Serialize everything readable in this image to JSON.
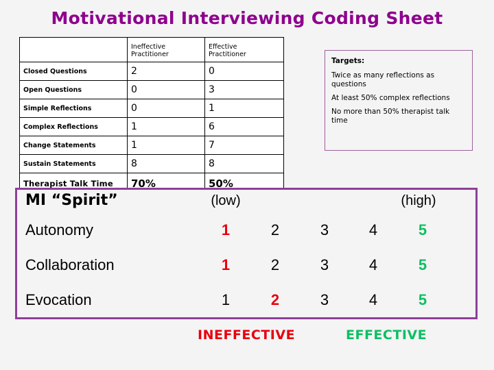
{
  "title": "Motivational Interviewing Coding Sheet",
  "colors": {
    "title_purple": "#8e008e",
    "panel_border_purple": "#8e3f99",
    "targets_border_purple": "#9b5f9b",
    "ineffective_red": "#e8000d",
    "effective_green": "#0dbf63",
    "page_background": "#f4f4f4"
  },
  "coding_table": {
    "headers": [
      "",
      "Ineffective Practitioner",
      "Effective Practitioner"
    ],
    "header_lines": {
      "col1_line1": "Ineffective",
      "col1_line2": "Practitioner",
      "col2_line1": "Effective",
      "col2_line2": "Practitioner"
    },
    "rows": [
      {
        "label": "Closed Questions",
        "ineffective": "2",
        "effective": "0"
      },
      {
        "label": "Open Questions",
        "ineffective": "0",
        "effective": "3"
      },
      {
        "label": "Simple Reflections",
        "ineffective": "0",
        "effective": "1"
      },
      {
        "label": "Complex Reflections",
        "ineffective": "1",
        "effective": "6"
      },
      {
        "label": "Change Statements",
        "ineffective": "1",
        "effective": "7"
      },
      {
        "label": "Sustain Statements",
        "ineffective": "8",
        "effective": "8"
      },
      {
        "label": "Therapist Talk Time",
        "ineffective": "70%",
        "effective": "50%"
      }
    ]
  },
  "targets": {
    "heading": "Targets:",
    "items": [
      "Twice as many reflections as questions",
      "At least 50% complex reflections",
      "No more than 50% therapist talk time"
    ]
  },
  "spirit": {
    "title": "MI “Spirit”",
    "scale_low_label": "(low)",
    "scale_high_label": "(high)",
    "scale_values": [
      "1",
      "2",
      "3",
      "4",
      "5"
    ],
    "rows": [
      {
        "name": "Autonomy",
        "values": [
          "1",
          "2",
          "3",
          "4",
          "5"
        ],
        "marked_low": "1",
        "marked_high": "5"
      },
      {
        "name": "Collaboration",
        "values": [
          "1",
          "2",
          "3",
          "4",
          "5"
        ],
        "marked_low": "1",
        "marked_high": "5"
      },
      {
        "name": "Evocation",
        "values": [
          "1",
          "2",
          "3",
          "4",
          "5"
        ],
        "marked_low": "2",
        "marked_high": "5"
      }
    ]
  },
  "footer": {
    "ineffective_label": "INEFFECTIVE",
    "effective_label": "EFFECTIVE"
  }
}
